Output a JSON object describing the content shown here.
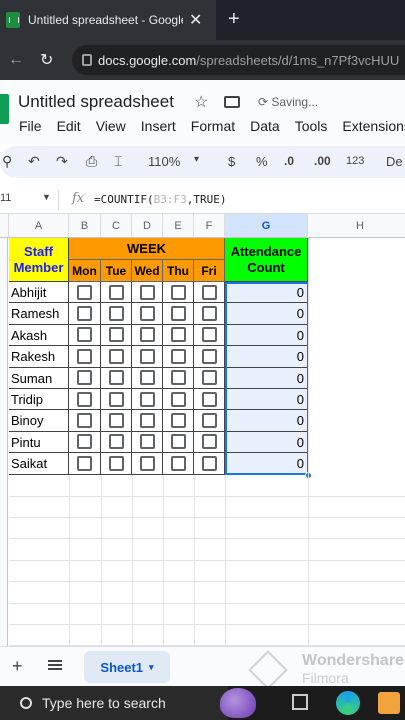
{
  "browser": {
    "tab_title": "Untitled spreadsheet - Google S",
    "tab_close": "✕",
    "new_tab": "+",
    "back": "←",
    "reload": "↻",
    "url_host": "docs.google.com",
    "url_path": "/spreadsheets/d/1ms_n7Pf3vcHUU"
  },
  "sheets": {
    "doc_title": "Untitled spreadsheet",
    "star": "☆",
    "status": "Saving...",
    "menu": [
      "File",
      "Edit",
      "View",
      "Insert",
      "Format",
      "Data",
      "Tools",
      "Extensions"
    ]
  },
  "toolbar": {
    "search": "⚲",
    "undo": "↶",
    "redo": "↷",
    "print": "⎙",
    "paint": "🖌",
    "zoom": "110%",
    "zoom_caret": "▾",
    "currency": "$",
    "percent": "%",
    "dec_decrease": ".0",
    "dec_increase": ".00",
    "number_format": "123",
    "default_font": "De"
  },
  "formula_bar": {
    "name_box": "11",
    "fx": "fx",
    "formula_prefix": "=COUNTIF(",
    "formula_ref": "B3:F3",
    "formula_suffix": ",TRUE)"
  },
  "columns": [
    "A",
    "B",
    "C",
    "D",
    "E",
    "F",
    "G",
    "H"
  ],
  "table": {
    "header_staff": "Staff Member",
    "header_week": "WEEK",
    "days": [
      "Mon",
      "Tue",
      "Wed",
      "Thu",
      "Fri"
    ],
    "header_count": "Attendance Count",
    "rows": [
      {
        "name": "Abhijit",
        "count": "0"
      },
      {
        "name": "Ramesh",
        "count": "0"
      },
      {
        "name": "Akash",
        "count": "0"
      },
      {
        "name": "Rakesh",
        "count": "0"
      },
      {
        "name": "Suman",
        "count": "0"
      },
      {
        "name": "Tridip",
        "count": "0"
      },
      {
        "name": "Binoy",
        "count": "0"
      },
      {
        "name": "Pintu",
        "count": "0"
      },
      {
        "name": "Saikat",
        "count": "0"
      }
    ]
  },
  "colors": {
    "staff_header_bg": "#ffff00",
    "week_header_bg": "#ff9900",
    "count_header_bg": "#00ff00",
    "staff_header_text": "#1c1cff",
    "selection": "#1a73e8"
  },
  "sheet_tabs": {
    "add": "+",
    "active_sheet": "Sheet1",
    "caret": "▾"
  },
  "watermark": {
    "brand": "Wondershare",
    "product": "Filmora"
  },
  "taskbar": {
    "search_placeholder": "Type here to search"
  }
}
